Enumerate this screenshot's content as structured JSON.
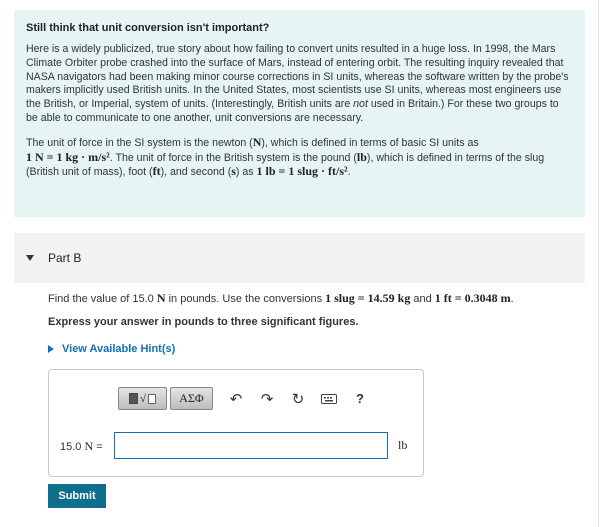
{
  "intro": {
    "heading": "Still think that unit conversion isn't important?",
    "p1_a": "Here is a widely publicized, true story about how failing to convert units resulted in a huge loss. In 1998, the Mars Climate Orbiter probe crashed into the surface of Mars, instead of entering orbit. The resulting inquiry revealed that NASA navigators had been making minor course corrections in SI units, whereas the software written by the probe's makers implicitly used British units. In the United States, most scientists use SI units, whereas most engineers use the British, or Imperial, system of units. (Interestingly, British units are ",
    "p1_em": "not",
    "p1_b": " used in Britain.) For these two groups to be able to communicate to one another, unit conversions are necessary.",
    "p2_a": "The unit of force in the SI system is the newton (",
    "p2_N": "N",
    "p2_b": "), which is defined in terms of basic SI units as",
    "p2_eq1": "1 N = 1 kg · m/s²",
    "p2_c": ". The unit of force in the British system is the pound (",
    "p2_lb": "lb",
    "p2_d": "), which is defined in terms of the slug (British unit of mass), foot (",
    "p2_ft": "ft",
    "p2_e": "), and second  (",
    "p2_s": "s",
    "p2_f": ") as ",
    "p2_eq2": "1 lb = 1 slug · ft/s²",
    "p2_g": "."
  },
  "part": {
    "label": "Part B"
  },
  "question": {
    "text_a": "Find the value of 15.0 ",
    "text_N": "N",
    "text_b": " in pounds. Use the conversions ",
    "conv1": "1 slug = 14.59 kg",
    "text_c": " and ",
    "conv2": "1 ft = 0.3048 m",
    "text_d": ".",
    "express": "Express your answer in pounds to three significant figures."
  },
  "hints": {
    "label": "View Available Hint(s)"
  },
  "toolbar": {
    "template_icon": "templates-icon",
    "greek_label": "ΑΣΦ",
    "undo_icon": "undo-icon",
    "redo_icon": "redo-icon",
    "reset_icon": "reset-icon",
    "keyboard_icon": "keyboard-icon",
    "help_label": "?"
  },
  "answer": {
    "lhs_value": "15.0 ",
    "lhs_unit": "N",
    "lhs_eq": " =",
    "value": "",
    "unit": "lb"
  },
  "submit": {
    "label": "Submit"
  },
  "colors": {
    "accent": "#0e72b5",
    "submit_bg": "#0e6f8c",
    "intro_bg": "#e6f4f4",
    "part_bg": "#f2f2f2"
  }
}
